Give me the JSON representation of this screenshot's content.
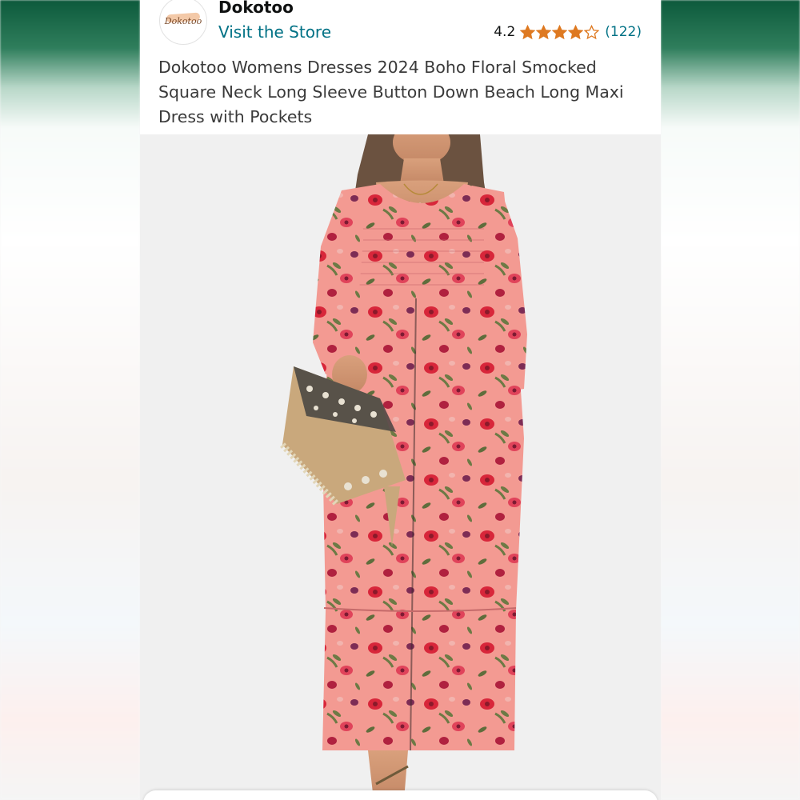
{
  "store": {
    "logo_text": "Dokotoo",
    "name": "Dokotoo",
    "link_label": "Visit the Store"
  },
  "rating": {
    "value": "4.2",
    "stars": 4.2,
    "count": "(122)"
  },
  "product": {
    "title": "Dokotoo Womens Dresses 2024 Boho Floral Smocked Square Neck Long Sleeve Button Down Beach Long Maxi Dress with Pockets",
    "image_icon": "product-photo"
  },
  "colors": {
    "link": "#007185",
    "star": "#de7921",
    "text": "#0f1111",
    "dress_base": "#f08f8a",
    "flower_red": "#d8263a",
    "leaf": "#6d7a45"
  }
}
